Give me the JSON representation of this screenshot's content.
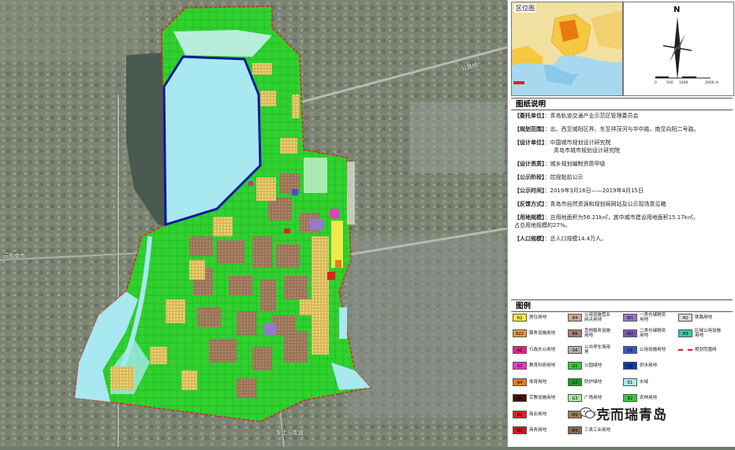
{
  "map": {
    "labels": {
      "west": "云胶南市",
      "south": "车上马街道",
      "road_ne": "公路线"
    }
  },
  "location_inset": {
    "title": "区位图"
  },
  "north_arrow": {
    "letter": "N",
    "scale_labels": [
      "0",
      "500",
      "1000",
      "2000 m"
    ]
  },
  "drawing_notes": {
    "title": "图纸说明",
    "rows": [
      {
        "key": "【委托单位】",
        "value": "：青岛轨道交通产业示范区管理委员会"
      },
      {
        "key": "【规划范围】",
        "value": "：北、西至城阳区界、东至祥茂河与华中路，南至向阳二号路。"
      },
      {
        "key": "【设计单位】",
        "value": "：中国城市规划设计研究院",
        "value2": "青岛市城市规划设计研究院"
      },
      {
        "key": "【设计资质】",
        "value": "：城乡规划编制资质甲级"
      },
      {
        "key": "【公示阶段】",
        "value": "：控规批前公示"
      },
      {
        "key": "【公示时间】",
        "value": "：2019年3月16日——2019年4月15日"
      },
      {
        "key": "【反馈方式】",
        "value": "：青岛市自然资源和规划局网站及公示现场意见箱"
      },
      {
        "key": "【用地规模】",
        "value": "：总用地面积为56.21k㎡，其中城市建设用地面积15.17k㎡，",
        "value2": "占总用地规模的27%。"
      },
      {
        "key": "【人口规模】",
        "value": "：总人口规模14.4万人。"
      }
    ]
  },
  "legend": {
    "title": "图例",
    "items": [
      {
        "code": "R2",
        "name": "居住用地",
        "color": "#f5f03a"
      },
      {
        "code": "B22",
        "name": "服务设施用地",
        "color": "#e89a3c"
      },
      {
        "code": "A1",
        "name": "行政办公用地",
        "color": "#e8208c"
      },
      {
        "code": "A3",
        "name": "教育科研用地",
        "color": "#e040c0"
      },
      {
        "code": "A4",
        "name": "体育用地",
        "color": "#e87820"
      },
      {
        "code": "A9",
        "name": "宗教设施用地",
        "color": "#4a1010"
      },
      {
        "code": "B1",
        "name": "商业用地",
        "color": "#e02020"
      },
      {
        "code": "B2",
        "name": "商务用地",
        "color": "#d01818"
      },
      {
        "code": "B4",
        "name": "公用设施营业网点用地",
        "color": "#c8a898"
      },
      {
        "code": "B9",
        "name": "其他服务设施用地",
        "color": "#a08070"
      },
      {
        "code": "S4",
        "name": "公共停车场用地",
        "color": "#b0b0b0"
      },
      {
        "code": "G1",
        "name": "公园绿地",
        "color": "#3cc83c"
      },
      {
        "code": "G2",
        "name": "防护绿地",
        "color": "#18a018"
      },
      {
        "code": "G3",
        "name": "广场用地",
        "color": "#a8e8a8"
      },
      {
        "code": "M2",
        "name": "二类工业用地",
        "color": "#9a7a5a"
      },
      {
        "code": "M3",
        "name": "三类工业用地",
        "color": "#8a6a4a"
      },
      {
        "code": "W1",
        "name": "一类仓储物流用地",
        "color": "#9878c8"
      },
      {
        "code": "W2",
        "name": "二类仓储物流用地",
        "color": "#7858b0"
      },
      {
        "code": "U1",
        "name": "公用设施用地",
        "color": "#3858c8"
      },
      {
        "code": "U2",
        "name": "供水用地",
        "color": "#1838a8"
      },
      {
        "code": "E1",
        "name": "水域",
        "color": "#a8e8f0"
      },
      {
        "code": "E2",
        "name": "农林用地",
        "color": "#38c838"
      },
      {
        "code": "H2",
        "name": "铁路用地",
        "color": "#d8d8d8"
      },
      {
        "code": "H3",
        "name": "区域公用设施用地",
        "color": "#38c8a8"
      },
      {
        "code": "",
        "name": "规划范围线",
        "color": "#d02020"
      }
    ]
  },
  "watermark": {
    "text": "克而瑞青岛"
  }
}
